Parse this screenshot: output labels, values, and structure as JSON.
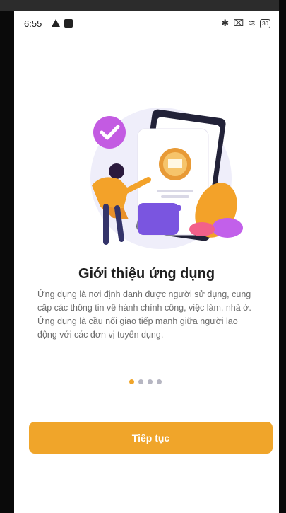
{
  "status_bar": {
    "time": "6:55",
    "battery": "30",
    "icons": [
      "warning-icon",
      "notification-icon",
      "bluetooth-icon",
      "close-box-icon",
      "wifi-icon",
      "battery-icon"
    ]
  },
  "onboarding": {
    "illustration": "intro-illustration",
    "title": "Giới thiệu ứng dụng",
    "description": "Ứng dụng là nơi định danh được người sử dụng, cung cấp các thông tin về hành chính công, việc làm, nhà ở. Ứng dụng là cầu nối giao tiếp mạnh giữa người lao động với các đơn vị tuyển dụng.",
    "page_indicator": {
      "total": 4,
      "current": 1
    },
    "continue_label": "Tiếp tục"
  },
  "colors": {
    "accent": "#f0a52a",
    "title": "#1f1f1f",
    "text": "#6c6c6c",
    "dot_inactive": "#b6b6c2",
    "illustration_purple": "#7a55e0",
    "illustration_pink": "#f2608a"
  }
}
